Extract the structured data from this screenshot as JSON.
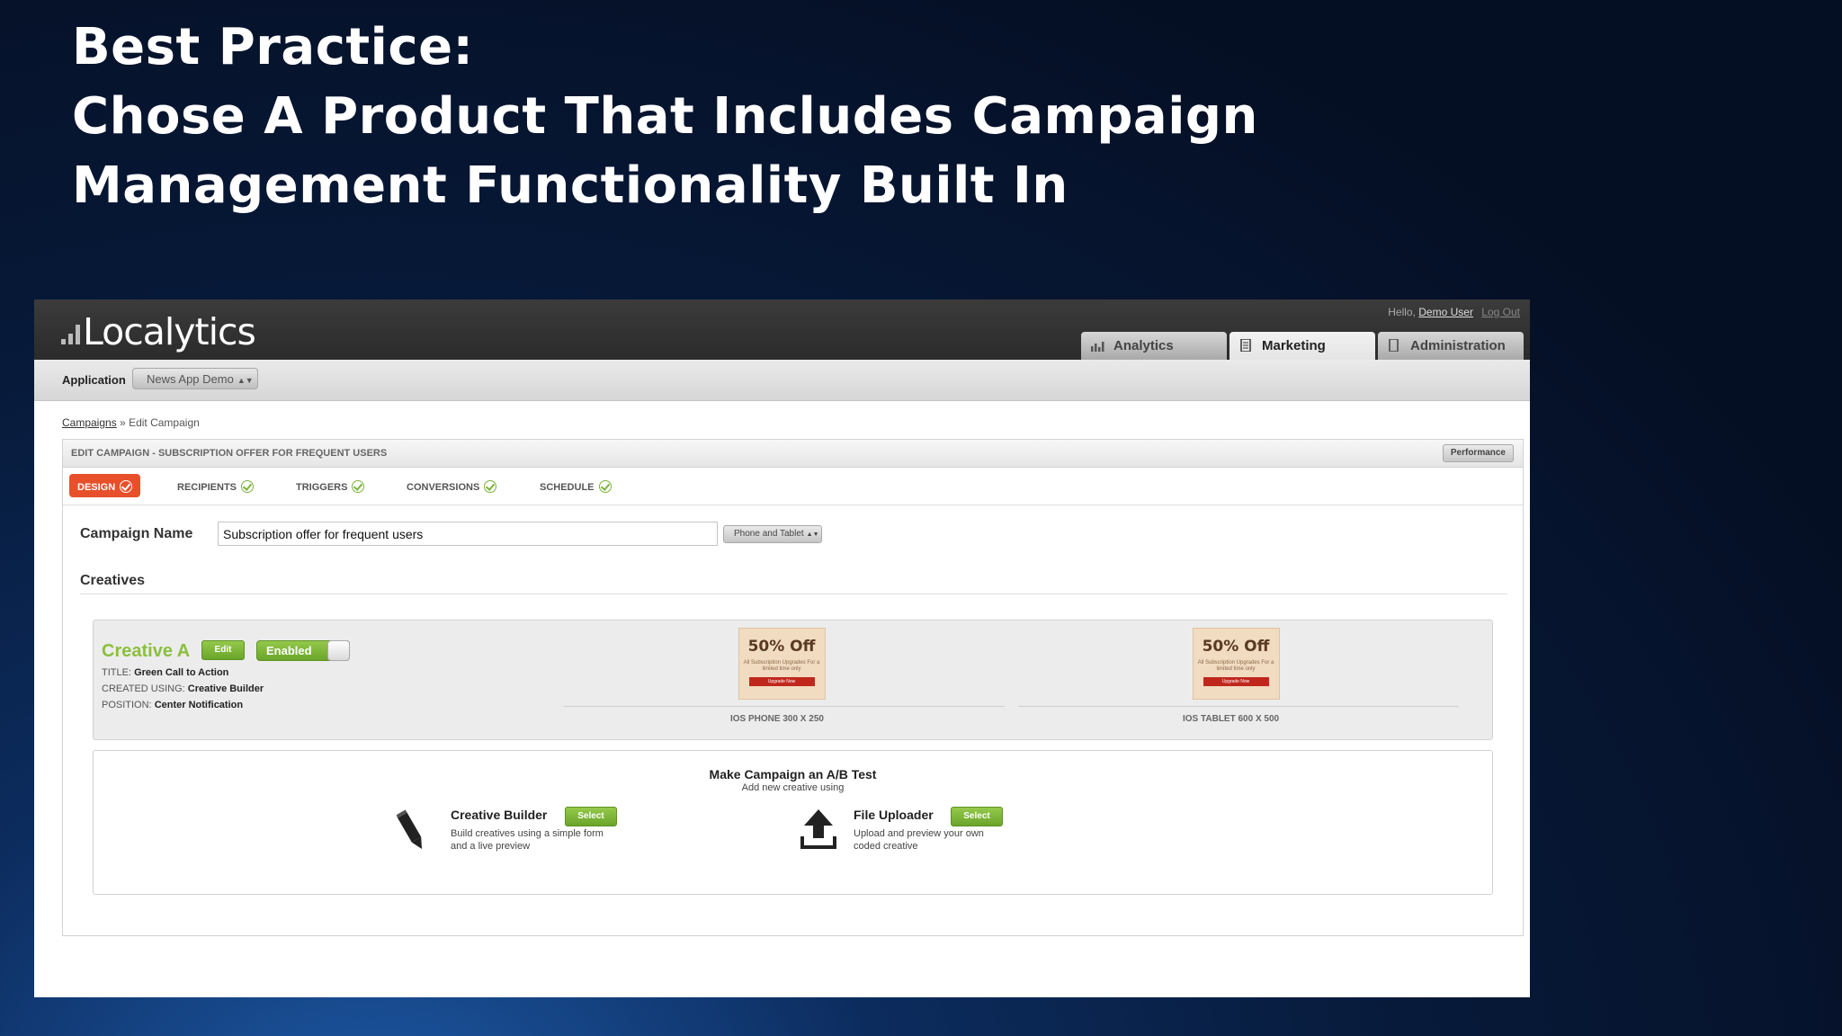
{
  "slide": {
    "title_lines": [
      "Best Practice:",
      "Chose A Product That Includes Campaign",
      "Management Functionality Built In"
    ]
  },
  "app": {
    "logo": "Localytics",
    "greeting": "Hello,",
    "user_name": "Demo User",
    "logout": "Log Out",
    "tabs": [
      {
        "label": "Analytics",
        "icon": "bar-chart-icon",
        "active": false
      },
      {
        "label": "Marketing",
        "icon": "document-icon",
        "active": true
      },
      {
        "label": "Administration",
        "icon": "tablet-icon",
        "active": false
      }
    ],
    "application_label": "Application",
    "application_value": "News App Demo"
  },
  "breadcrumb": {
    "link": "Campaigns",
    "separator": "»",
    "current": "Edit Campaign"
  },
  "campaign": {
    "header": "EDIT CAMPAIGN - SUBSCRIPTION OFFER FOR FREQUENT USERS",
    "performance_button": "Performance",
    "steps": [
      {
        "label": "DESIGN",
        "active": true
      },
      {
        "label": "RECIPIENTS",
        "active": false
      },
      {
        "label": "TRIGGERS",
        "active": false
      },
      {
        "label": "CONVERSIONS",
        "active": false
      },
      {
        "label": "SCHEDULE",
        "active": false
      }
    ],
    "name_label": "Campaign Name",
    "name_value": "Subscription offer for frequent users",
    "device_select": "Phone and Tablet",
    "creatives_label": "Creatives"
  },
  "creative": {
    "name": "Creative A",
    "edit_button": "Edit",
    "toggle_label": "Enabled",
    "meta": [
      {
        "key": "TITLE:",
        "value": "Green Call to Action"
      },
      {
        "key": "CREATED USING:",
        "value": "Creative Builder"
      },
      {
        "key": "POSITION:",
        "value": "Center Notification"
      }
    ],
    "previews": [
      {
        "headline": "50% Off",
        "sub": "All Subscription Upgrades For a limited time only",
        "cta": "Upgrade Now",
        "label": "IOS PHONE 300 X 250"
      },
      {
        "headline": "50% Off",
        "sub": "All Subscription Upgrades For a limited time only",
        "cta": "Upgrade Now",
        "label": "IOS TABLET 600 X 500"
      }
    ]
  },
  "ab_test": {
    "title": "Make Campaign an A/B Test",
    "subtitle": "Add new creative using",
    "tools": [
      {
        "name": "Creative Builder",
        "button": "Select",
        "desc": "Build creatives using a simple form and a live preview",
        "icon": "pencil-icon"
      },
      {
        "name": "File Uploader",
        "button": "Select",
        "desc": "Upload and preview your own coded creative",
        "icon": "upload-icon"
      }
    ]
  },
  "colors": {
    "accent_orange": "#e7502a",
    "accent_green": "#7bb33a",
    "topbar": "#2f2f2f",
    "slide_background": "#071a3a"
  }
}
